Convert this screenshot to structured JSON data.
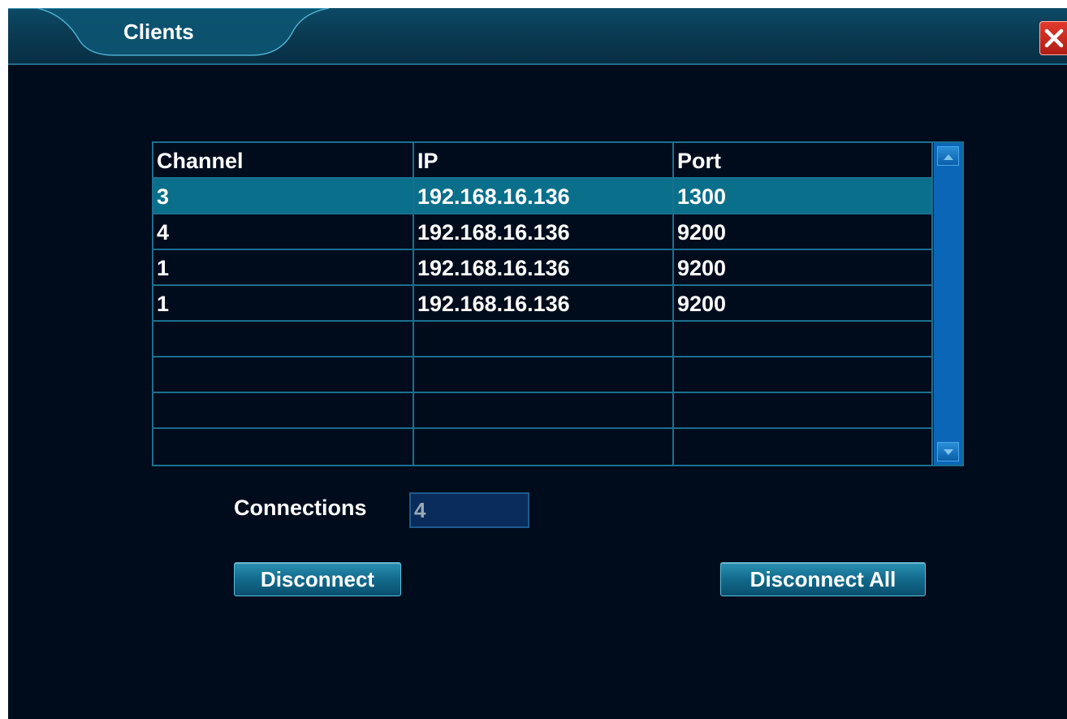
{
  "window": {
    "title": "Clients",
    "close_icon": "close-icon",
    "colors": {
      "background": "#000c1c",
      "accent": "#1b6f8f",
      "selected_row": "#0a6f8a",
      "close": "#d12a20"
    }
  },
  "table": {
    "headers": [
      "Channel",
      "IP",
      "Port"
    ],
    "rows": [
      [
        "3",
        "192.168.16.136",
        "1300"
      ],
      [
        "4",
        "192.168.16.136",
        "9200"
      ],
      [
        "1",
        "192.168.16.136",
        "9200"
      ],
      [
        "1",
        "192.168.16.136",
        "9200"
      ],
      [
        "",
        "",
        ""
      ],
      [
        "",
        "",
        ""
      ],
      [
        "",
        "",
        ""
      ],
      [
        "",
        "",
        ""
      ]
    ],
    "selected_row": 0
  },
  "connections": {
    "label": "Connections",
    "value": "4"
  },
  "buttons": {
    "disconnect": "Disconnect",
    "disconnect_all": "Disconnect All"
  }
}
